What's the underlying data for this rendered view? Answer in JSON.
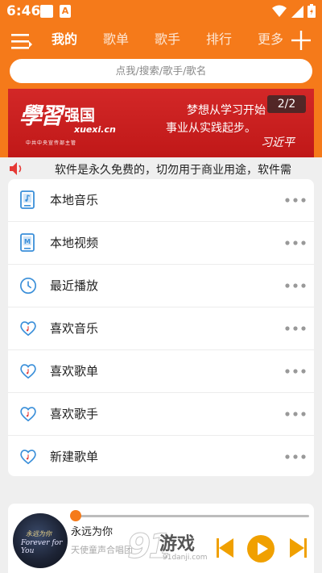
{
  "status": {
    "time": "6:46"
  },
  "nav": {
    "tabs": [
      "我的",
      "歌单",
      "歌手",
      "排行",
      "更多"
    ]
  },
  "search": {
    "placeholder": "点我/搜索/歌手/歌名"
  },
  "banner": {
    "logo_script": "學習",
    "logo_text": "强国",
    "logo_sub": "xuexi.cn",
    "logo_tiny": "中共中央宣传部主管",
    "slogan_line1": "梦想从学习开始",
    "slogan_line2": "事业从实践起步。",
    "signature": "习近平",
    "counter": "2/2"
  },
  "notice": {
    "text": "软件是永久免费的，切勿用于商业用途，软件需"
  },
  "library": {
    "items": [
      {
        "label": "本地音乐",
        "icon": "music-file-icon"
      },
      {
        "label": "本地视频",
        "icon": "video-file-icon"
      },
      {
        "label": "最近播放",
        "icon": "clock-icon"
      },
      {
        "label": "喜欢音乐",
        "icon": "heart-note-icon"
      },
      {
        "label": "喜欢歌单",
        "icon": "heart-note-icon"
      },
      {
        "label": "喜欢歌手",
        "icon": "heart-note-icon"
      },
      {
        "label": "新建歌单",
        "icon": "heart-note-icon"
      }
    ]
  },
  "player": {
    "title": "永远为你",
    "artist": "天使童声合唱团",
    "album_text1": "永远为你",
    "album_text2": "Forever for You",
    "progress": 0.0,
    "watermark_num": "91",
    "watermark_text": "游戏",
    "watermark_url": "91danji.com"
  },
  "colors": {
    "accent": "#f57a1a",
    "icon_blue": "#3a8fd9"
  }
}
